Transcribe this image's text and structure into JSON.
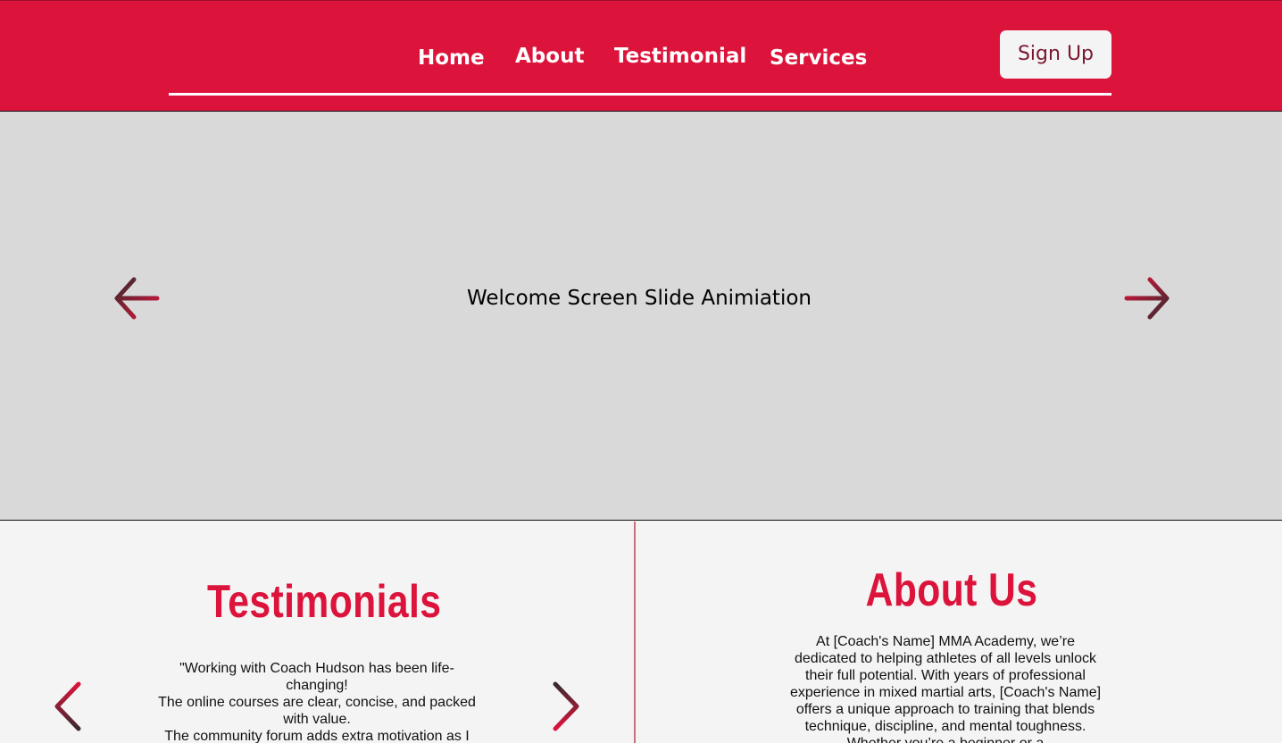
{
  "header": {
    "nav": [
      {
        "label": "Home"
      },
      {
        "label": "About"
      },
      {
        "label": "Testimonial"
      },
      {
        "label": "Services"
      }
    ],
    "signup_label": "Sign Up"
  },
  "hero": {
    "title": "Welcome Screen Slide Animiation",
    "prev_icon": "arrow-left-icon",
    "next_icon": "arrow-right-icon"
  },
  "testimonials": {
    "heading": "Testimonials",
    "quote_lines": [
      "\"Working with Coach Hudson has been life-changing!",
      "The online courses are clear, concise, and packed with value.",
      "The community forum adds extra motivation as I"
    ],
    "prev_icon": "chevron-left-icon",
    "next_icon": "chevron-right-icon"
  },
  "about": {
    "heading": "About Us",
    "body": "At [Coach's Name] MMA Academy, we’re dedicated to helping athletes of all levels unlock their full potential. With years of professional experience in mixed martial arts, [Coach's Name] offers a unique approach to training that blends technique, discipline, and mental toughness. Whether you’re a beginner or a"
  },
  "colors": {
    "brand_red": "#dc143c",
    "dark_maroon": "#3a2a2e",
    "hero_bg": "#d9d9d9",
    "page_bg": "#f4f4f4"
  }
}
